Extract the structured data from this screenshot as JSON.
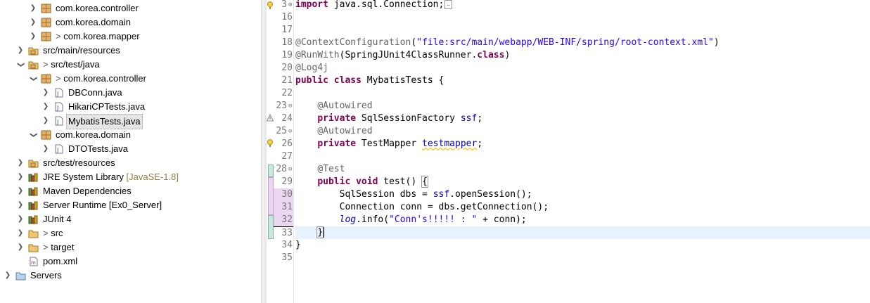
{
  "explorer": {
    "items": [
      {
        "label": "com.korea.controller",
        "prefix": "",
        "icon": "package-icon",
        "twisty": "expand"
      },
      {
        "label": "com.korea.domain",
        "prefix": "",
        "icon": "package-icon",
        "twisty": "expand"
      },
      {
        "label": "com.korea.mapper",
        "prefix": "> ",
        "icon": "package-icon",
        "twisty": "expand"
      },
      {
        "label": "src/main/resources",
        "prefix": "",
        "icon": "source-folder-icon",
        "twisty": "expand"
      },
      {
        "label": "src/test/java",
        "prefix": "> ",
        "icon": "source-folder-icon",
        "twisty": "collapse"
      },
      {
        "label": "com.korea.controller",
        "prefix": "> ",
        "icon": "package-icon",
        "twisty": "collapse"
      },
      {
        "label": "DBConn.java",
        "prefix": "",
        "icon": "java-file-icon",
        "twisty": "expand"
      },
      {
        "label": "HikariCPTests.java",
        "prefix": "",
        "icon": "java-file-icon",
        "twisty": "expand"
      },
      {
        "label": "MybatisTests.java",
        "prefix": "",
        "icon": "java-file-icon",
        "twisty": "expand"
      },
      {
        "label": "com.korea.domain",
        "prefix": "",
        "icon": "package-icon",
        "twisty": "collapse"
      },
      {
        "label": "DTOTests.java",
        "prefix": "",
        "icon": "java-file-icon",
        "twisty": "expand"
      },
      {
        "label": "src/test/resources",
        "prefix": "",
        "icon": "source-folder-icon",
        "twisty": "expand"
      },
      {
        "label": "JRE System Library",
        "prefix": "",
        "icon": "library-icon",
        "twisty": "expand",
        "decoration": "[JavaSE-1.8]"
      },
      {
        "label": "Maven Dependencies",
        "prefix": "",
        "icon": "library-icon",
        "twisty": "expand"
      },
      {
        "label": "Server Runtime [Ex0_Server]",
        "prefix": "",
        "icon": "library-icon",
        "twisty": "expand"
      },
      {
        "label": "JUnit 4",
        "prefix": "",
        "icon": "library-icon",
        "twisty": "expand"
      },
      {
        "label": "src",
        "prefix": "> ",
        "icon": "folder-icon",
        "twisty": "expand"
      },
      {
        "label": "target",
        "prefix": "> ",
        "icon": "folder-icon",
        "twisty": "expand"
      },
      {
        "label": "pom.xml",
        "prefix": "",
        "icon": "xml-file-icon",
        "twisty": "none"
      },
      {
        "label": "Servers",
        "prefix": "",
        "icon": "folder-icon",
        "twisty": "expand"
      }
    ]
  },
  "editor": {
    "line_numbers": [
      "3",
      "16",
      "17",
      "18",
      "19",
      "20",
      "21",
      "22",
      "23",
      "24",
      "25",
      "26",
      "27",
      "28",
      "29",
      "30",
      "31",
      "32",
      "33",
      "34",
      "35"
    ],
    "code": {
      "l3_kw": "import",
      "l3_rest": " java.sql.Connection;",
      "l18_ann": "@ContextConfiguration",
      "l18_p1": "(",
      "l18_str": "\"file:src/main/webapp/WEB-INF/spring/root-context.xml\"",
      "l18_p2": ")",
      "l19_ann": "@RunWith",
      "l19_p1": "(SpringJUnit4ClassRunner.",
      "l19_kw": "class",
      "l19_p2": ")",
      "l20_ann": "@Log4j",
      "l21_kw1": "public",
      "l21_kw2": "class",
      "l21_rest": " MybatisTests {",
      "l23_ann": "@Autowired",
      "l24_kw": "private",
      "l24_type": " SqlSessionFactory ",
      "l24_fld": "ssf",
      "l24_end": ";",
      "l25_ann": "@Autowired",
      "l26_kw": "private",
      "l26_type": " TestMapper ",
      "l26_fld": "testmapper",
      "l26_end": ";",
      "l28_ann": "@Test",
      "l29_kw1": "public",
      "l29_kw2": "void",
      "l29_rest": " test() ",
      "l29_brace": "{",
      "l30_a": "SqlSession dbs = ",
      "l30_fld": "ssf",
      "l30_b": ".openSession();",
      "l31_a": "Connection conn = dbs.getConnection();",
      "l32_fld": "log",
      "l32_a": ".info(",
      "l32_str": "\"Conn's!!!!! : \"",
      "l32_b": " + conn);",
      "l33_a": "}",
      "l34_a": "}"
    }
  },
  "colors": {
    "keyword": "#7f0055",
    "annotation": "#646464",
    "string": "#2a00ff",
    "field": "#0000c0",
    "current_line": "#e8f2fe"
  }
}
